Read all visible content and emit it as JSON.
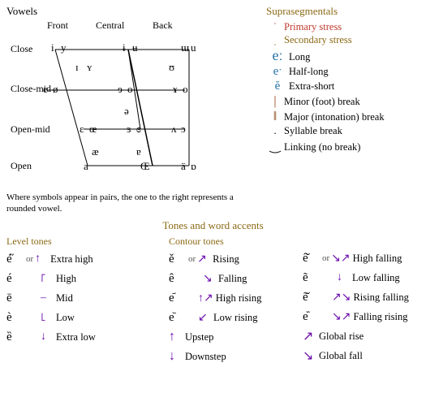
{
  "vowels": {
    "title": "Vowels",
    "headers": [
      "Front",
      "Central",
      "Back"
    ],
    "rowLabels": [
      "Close",
      "Close-mid",
      "Open-mid",
      "Open"
    ],
    "note": "Where symbols appear in pairs, the one to the right\nrepresents a rounded vowel."
  },
  "suprasegmentals": {
    "title": "Suprasegmentals",
    "items": [
      {
        "symbol": "ˈ",
        "label": "Primary stress",
        "colorClass": "color-primary"
      },
      {
        "symbol": "ˌ",
        "label": "Secondary stress",
        "colorClass": "color-secondary"
      },
      {
        "symbol": "eː",
        "label": "Long",
        "colorClass": "color-long"
      },
      {
        "symbol": "eˑ",
        "label": "Half-long",
        "colorClass": "color-halflong"
      },
      {
        "symbol": "ĕ",
        "label": "Extra-short",
        "colorClass": "color-extrashort"
      },
      {
        "symbol": "|",
        "label": "Minor (foot) break",
        "colorClass": "color-minor"
      },
      {
        "symbol": "‖",
        "label": "Major (intonation) break",
        "colorClass": "color-major"
      },
      {
        "symbol": ".",
        "label": "Syllable break",
        "colorClass": "color-syllable"
      },
      {
        "symbol": "‿",
        "label": "Linking (no break)",
        "colorClass": "color-linking"
      }
    ]
  },
  "tones": {
    "title": "Tones and word accents",
    "levelTitle": "Level tones",
    "contourTitle": "Contour tones",
    "levelRows": [
      {
        "letter": "é̋",
        "symbol": "↑",
        "desc": "Extra high"
      },
      {
        "letter": "é",
        "symbol": "꜒",
        "desc": "High"
      },
      {
        "letter": "ē",
        "symbol": "꜔",
        "desc": "Mid"
      },
      {
        "letter": "è",
        "symbol": "꜖",
        "desc": "Low"
      },
      {
        "letter": "ȅ",
        "symbol": "↓",
        "desc": "Extra low"
      }
    ],
    "contourRows": [
      {
        "letter": "ě",
        "symbol": "↗",
        "desc": "Rising"
      },
      {
        "letter": "ê",
        "symbol": "↘",
        "desc": "Falling"
      },
      {
        "letter": "e᷄",
        "symbol": "↑↗",
        "desc": "High rising"
      },
      {
        "letter": "e᷅",
        "symbol": "↙",
        "desc": "Low rising"
      },
      {
        "symbol2": "↑",
        "desc2": "Upstep"
      },
      {
        "symbol2": "↓",
        "desc2": "Downstep"
      }
    ],
    "rightRows": [
      {
        "letter": "ê̌",
        "symbol": "↘↗",
        "desc": "High falling"
      },
      {
        "letter": "ẽ",
        "symbol": "↓",
        "desc": "Low falling"
      },
      {
        "letter": "ẽ̌",
        "symbol": "↗↘",
        "desc": "Rising falling"
      },
      {
        "letter": "e᷈",
        "symbol": "↘↗",
        "desc": "Falling rising"
      },
      {
        "symbol2": "↗",
        "desc2": "Global rise"
      },
      {
        "symbol2": "↘",
        "desc2": "Global fall"
      }
    ]
  }
}
